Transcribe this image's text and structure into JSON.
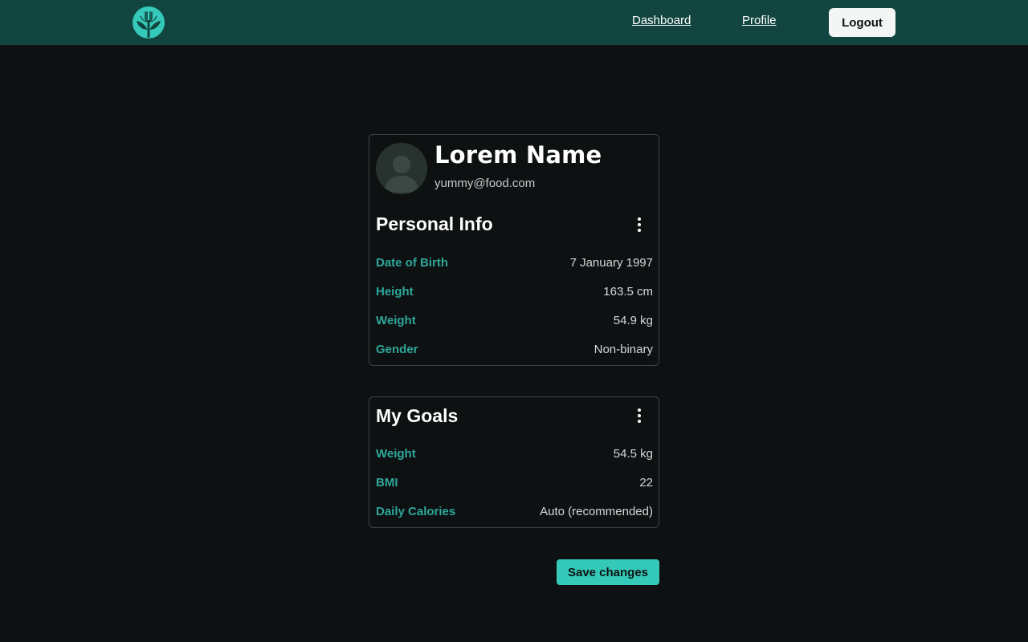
{
  "nav": {
    "logo_icon": "tree-fork-logo-icon",
    "links": [
      {
        "label": "Dashboard"
      },
      {
        "label": "Profile"
      }
    ],
    "logout_label": "Logout"
  },
  "profile": {
    "name": "Lorem Name",
    "email": "yummy@food.com",
    "avatar_icon": "user-avatar-icon"
  },
  "personal_info": {
    "title": "Personal Info",
    "menu_icon": "more-vertical-icon",
    "fields": [
      {
        "label": "Date of Birth",
        "value": "7 January 1997"
      },
      {
        "label": "Height",
        "value": "163.5 cm"
      },
      {
        "label": "Weight",
        "value": "54.9 kg"
      },
      {
        "label": "Gender",
        "value": "Non-binary"
      }
    ]
  },
  "goals": {
    "title": "My Goals",
    "menu_icon": "more-vertical-icon",
    "fields": [
      {
        "label": "Weight",
        "value": "54.5 kg"
      },
      {
        "label": "BMI",
        "value": "22"
      },
      {
        "label": "Daily Calories",
        "value": "Auto (recommended)"
      }
    ]
  },
  "actions": {
    "save_label": "Save changes"
  },
  "colors": {
    "navbar_bg": "#124540",
    "page_bg": "#0e1111",
    "accent": "#34c9b9",
    "label_teal": "#2ea79b"
  }
}
